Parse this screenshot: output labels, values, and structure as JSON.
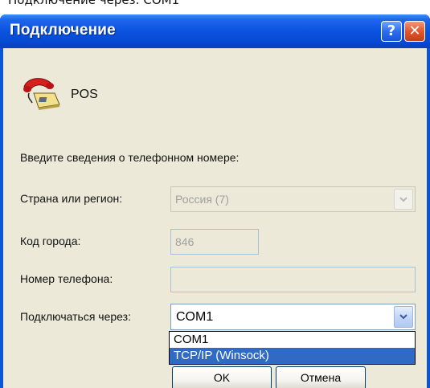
{
  "top_strip_text": "Подключение через: COM1",
  "window": {
    "title": "Подключение"
  },
  "title_buttons": {
    "help": "?",
    "close": "✕"
  },
  "connection_name": "POS",
  "instruction": "Введите сведения о телефонном номере:",
  "country": {
    "label": "Страна или регион:",
    "value": "Россия (7)"
  },
  "area_code": {
    "label": "Код города:",
    "value": "846"
  },
  "phone": {
    "label": "Номер телефона:",
    "value": ""
  },
  "connect_using": {
    "label": "Подключаться через:",
    "value": "COM1",
    "options": [
      "COM1",
      "TCP/IP (Winsock)"
    ],
    "highlighted": "TCP/IP (Winsock)"
  },
  "buttons": {
    "ok": "OK",
    "cancel": "Отмена"
  },
  "icons": {
    "phone": "telephone-icon",
    "dropdown": "chevron-down-icon"
  },
  "colors": {
    "titlebar": "#0a53e0",
    "client_bg": "#ece9d8",
    "selection": "#316ac5",
    "close_button": "#e3562b"
  }
}
